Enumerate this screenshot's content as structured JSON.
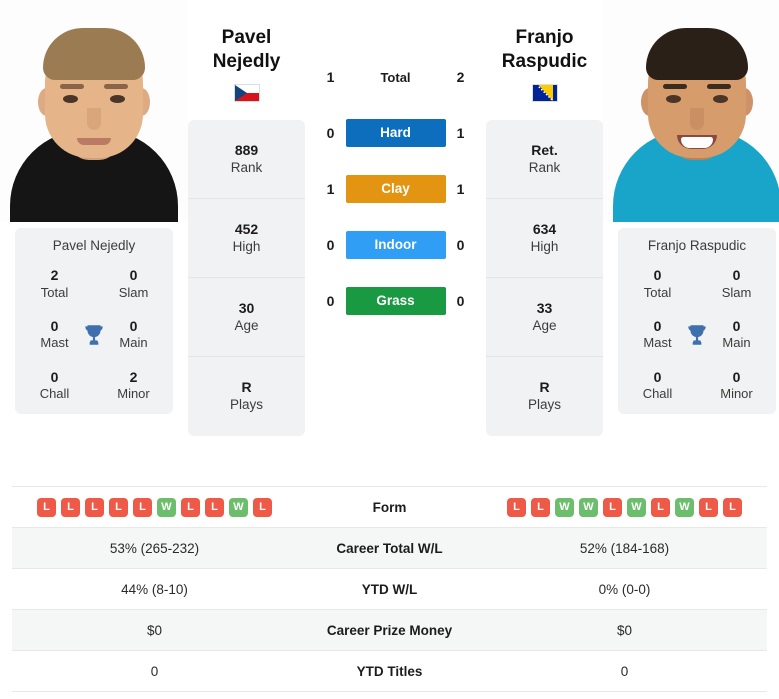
{
  "colors": {
    "hard": "#0d6ebd",
    "clay": "#e39410",
    "indoor": "#2f9ef4",
    "grass": "#199a42",
    "win": "#6cbd6c",
    "loss": "#ef5a48",
    "trophy": "#3d70ad",
    "card_bg": "#f1f2f3"
  },
  "left_player": {
    "name_line1": "Pavel",
    "name_line2": "Nejedly",
    "full_name": "Pavel Nejedly",
    "flag": "czech-republic-flag",
    "photo": "player-photo",
    "stats": [
      {
        "value": "889",
        "label": "Rank"
      },
      {
        "value": "452",
        "label": "High"
      },
      {
        "value": "30",
        "label": "Age"
      },
      {
        "value": "R",
        "label": "Plays"
      }
    ],
    "titles": [
      {
        "value": "2",
        "label": "Total"
      },
      {
        "value": "0",
        "label": "Slam"
      },
      {
        "value": "0",
        "label": "Mast"
      },
      {
        "value": "0",
        "label": "Main"
      },
      {
        "value": "0",
        "label": "Chall"
      },
      {
        "value": "2",
        "label": "Minor"
      }
    ],
    "form": [
      "L",
      "L",
      "L",
      "L",
      "L",
      "W",
      "L",
      "L",
      "W",
      "L"
    ]
  },
  "right_player": {
    "name_line1": "Franjo",
    "name_line2": "Raspudic",
    "full_name": "Franjo Raspudic",
    "flag": "bosnia-herzegovina-flag",
    "photo": "player-photo",
    "stats": [
      {
        "value": "Ret.",
        "label": "Rank"
      },
      {
        "value": "634",
        "label": "High"
      },
      {
        "value": "33",
        "label": "Age"
      },
      {
        "value": "R",
        "label": "Plays"
      }
    ],
    "titles": [
      {
        "value": "0",
        "label": "Total"
      },
      {
        "value": "0",
        "label": "Slam"
      },
      {
        "value": "0",
        "label": "Mast"
      },
      {
        "value": "0",
        "label": "Main"
      },
      {
        "value": "0",
        "label": "Chall"
      },
      {
        "value": "0",
        "label": "Minor"
      }
    ],
    "form": [
      "L",
      "L",
      "W",
      "W",
      "L",
      "W",
      "L",
      "W",
      "L",
      "L"
    ]
  },
  "head_to_head": [
    {
      "left": "1",
      "label": "Total",
      "right": "2",
      "type": "total"
    },
    {
      "left": "0",
      "label": "Hard",
      "right": "1",
      "type": "hard"
    },
    {
      "left": "1",
      "label": "Clay",
      "right": "1",
      "type": "clay"
    },
    {
      "left": "0",
      "label": "Indoor",
      "right": "0",
      "type": "indoor"
    },
    {
      "left": "0",
      "label": "Grass",
      "right": "0",
      "type": "grass"
    }
  ],
  "comparison_rows": [
    {
      "label": "Form",
      "left": "",
      "right": "",
      "kind": "form"
    },
    {
      "label": "Career Total W/L",
      "left": "53% (265-232)",
      "right": "52% (184-168)",
      "kind": "text"
    },
    {
      "label": "YTD W/L",
      "left": "44% (8-10)",
      "right": "0% (0-0)",
      "kind": "text"
    },
    {
      "label": "Career Prize Money",
      "left": "$0",
      "right": "$0",
      "kind": "text"
    },
    {
      "label": "YTD Titles",
      "left": "0",
      "right": "0",
      "kind": "text"
    }
  ]
}
